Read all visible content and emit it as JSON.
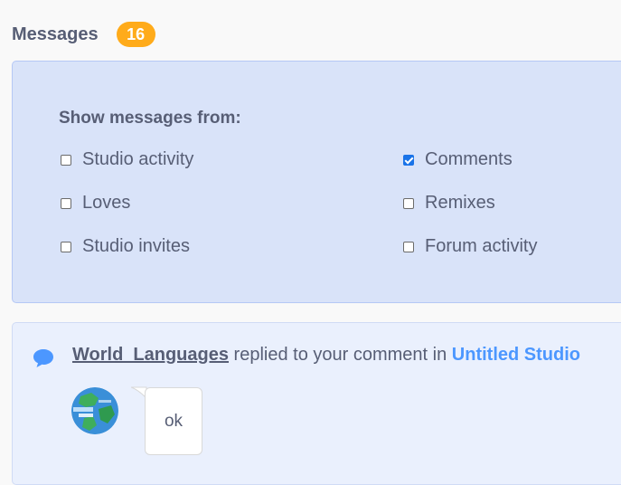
{
  "header": {
    "title": "Messages",
    "count": "16"
  },
  "filters": {
    "heading": "Show messages from:",
    "options": [
      {
        "label": "Studio activity",
        "checked": false
      },
      {
        "label": "Comments",
        "checked": true
      },
      {
        "label": "Loves",
        "checked": false
      },
      {
        "label": "Remixes",
        "checked": false
      },
      {
        "label": "Studio invites",
        "checked": false
      },
      {
        "label": "Forum activity",
        "checked": false
      }
    ]
  },
  "message": {
    "icon": "speech-bubble-icon",
    "user": "World_Languages",
    "action": " replied to your comment in ",
    "target": "Untitled Studio",
    "reply": "ok"
  },
  "colors": {
    "badge": "#ffab1a",
    "link": "#4c97ff",
    "filter_bg": "#d9e3f9",
    "card_bg": "#eaf0fd",
    "text": "#575e75"
  }
}
